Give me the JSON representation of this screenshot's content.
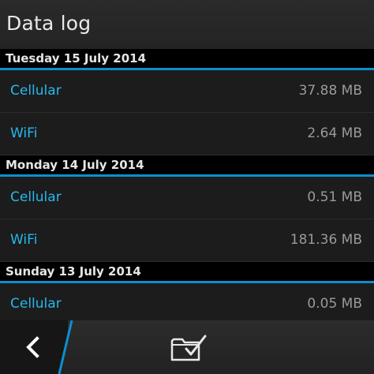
{
  "header": {
    "title": "Data log"
  },
  "sections": [
    {
      "date": "Tuesday 15 July 2014",
      "rows": [
        {
          "label": "Cellular",
          "value": "37.88 MB"
        },
        {
          "label": "WiFi",
          "value": "2.64 MB"
        }
      ]
    },
    {
      "date": "Monday 14 July 2014",
      "rows": [
        {
          "label": "Cellular",
          "value": "0.51 MB"
        },
        {
          "label": "WiFi",
          "value": "181.36 MB"
        }
      ]
    },
    {
      "date": "Sunday 13 July 2014",
      "rows": [
        {
          "label": "Cellular",
          "value": "0.05 MB"
        }
      ]
    }
  ],
  "actionbar": {
    "back_icon": "back-chevron-icon",
    "action_icon": "folder-check-icon"
  },
  "colors": {
    "accent": "#0b8fcf",
    "label": "#26b8ee",
    "value": "#9a9a9a",
    "background": "#1c1c1c"
  }
}
